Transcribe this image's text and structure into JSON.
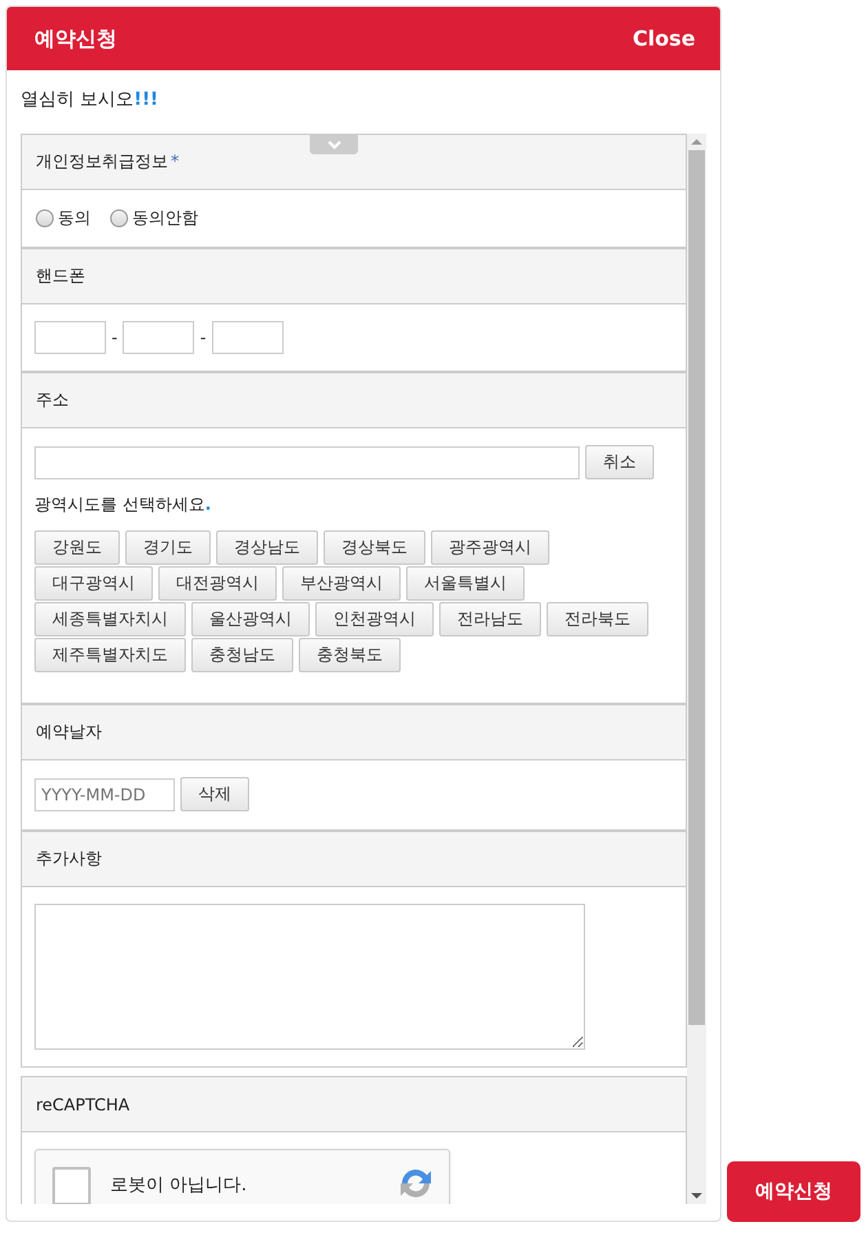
{
  "modal": {
    "title": "예약신청",
    "close": "Close"
  },
  "intro": {
    "text": "열심히 보시오",
    "accent": "!!!"
  },
  "sections": [
    {
      "kind": "radio",
      "title": "개인정보취급정보",
      "required_mark": "*",
      "options": [
        {
          "label": "동의",
          "selected": false
        },
        {
          "label": "동의안함",
          "selected": false
        }
      ]
    },
    {
      "kind": "phone",
      "title": "핸드폰",
      "separator": "-"
    },
    {
      "kind": "address",
      "title": "주소",
      "button": "취소",
      "hint": "광역시도를 선택하세요",
      "hint_end": ".",
      "regions": [
        "강원도",
        "경기도",
        "경상남도",
        "경상북도",
        "광주광역시",
        "대구광역시",
        "대전광역시",
        "부산광역시",
        "서울특별시",
        "세종특별자치시",
        "울산광역시",
        "인천광역시",
        "전라남도",
        "전라북도",
        "제주특별자치도",
        "충청남도",
        "충청북도"
      ]
    },
    {
      "kind": "date",
      "title": "예약날자",
      "placeholder": "YYYY-MM-DD",
      "button": "삭제"
    },
    {
      "kind": "textarea",
      "title": "추가사항"
    },
    {
      "kind": "captcha",
      "title": "reCAPTCHA",
      "label": "로봇이 아닙니다.",
      "checked": false
    }
  ],
  "floating_button": "예약신청"
}
